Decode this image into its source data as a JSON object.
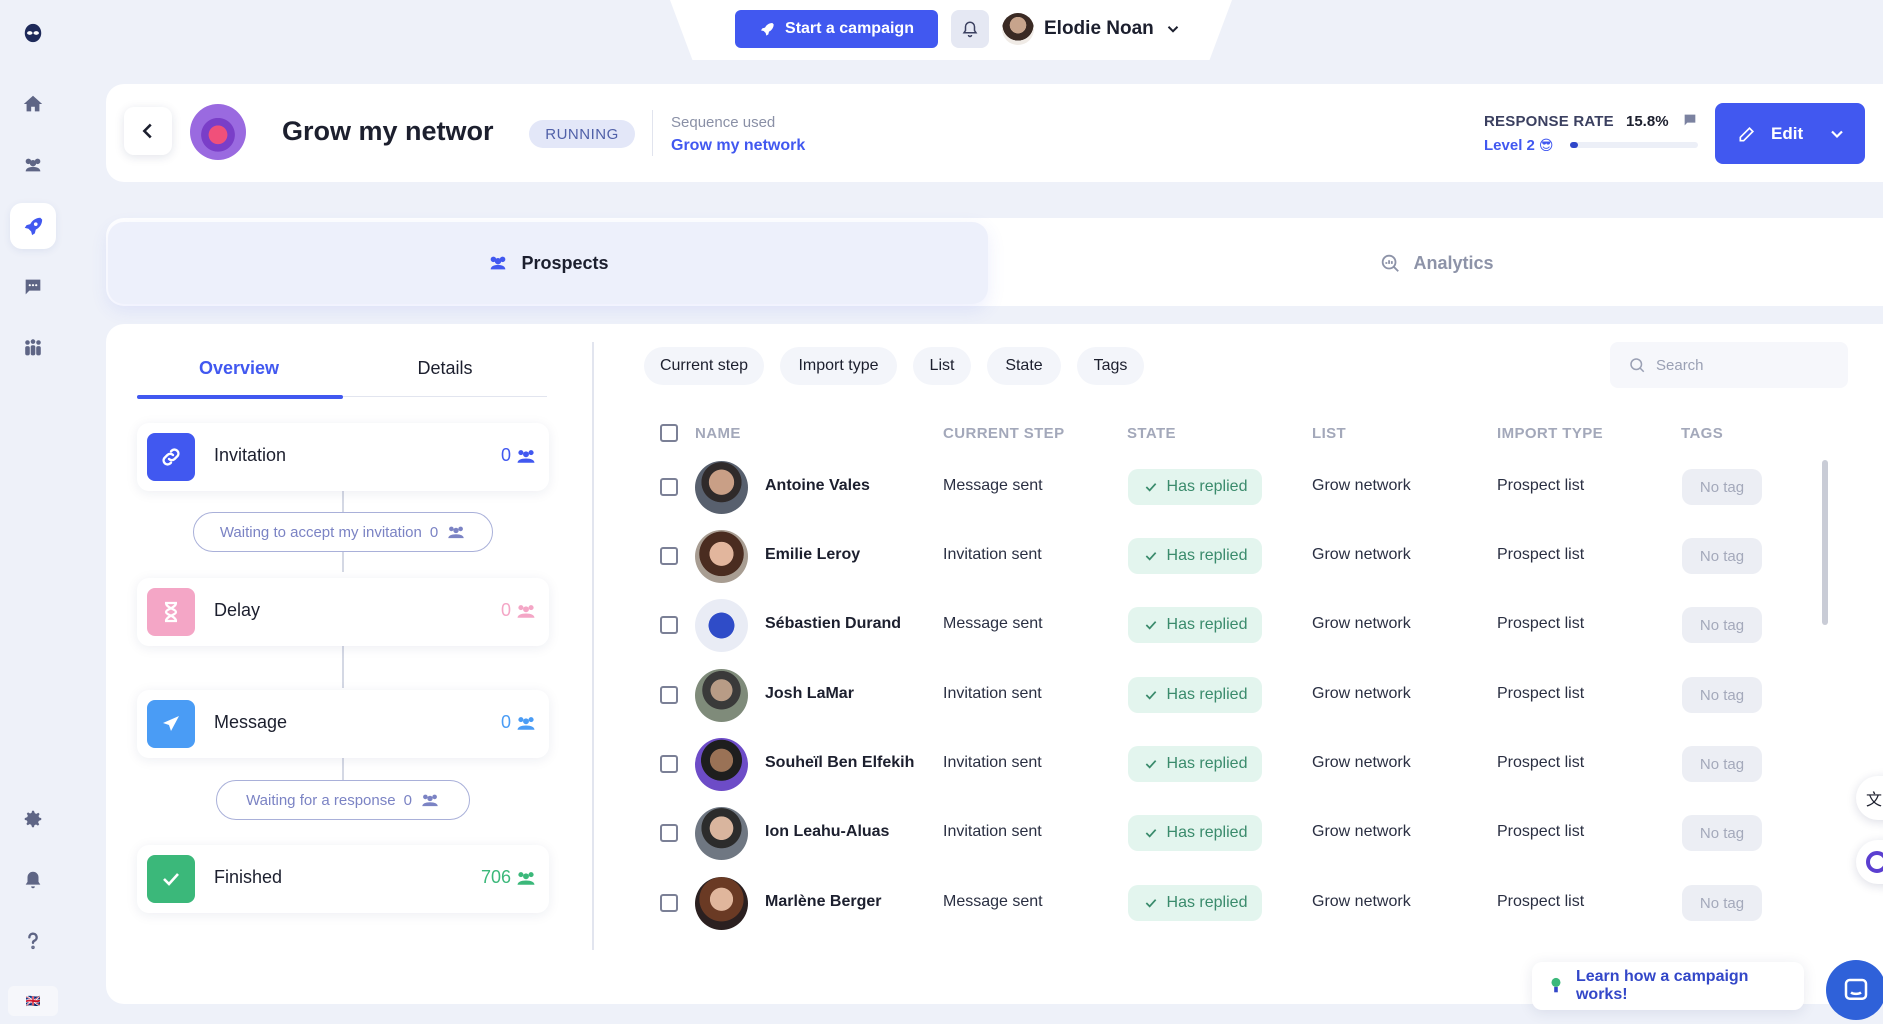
{
  "topbar": {
    "start_campaign": "Start a campaign",
    "user_name": "Elodie Noan"
  },
  "header": {
    "title": "Grow my networ",
    "status": "RUNNING",
    "sequence_label": "Sequence used",
    "sequence_value": "Grow my network",
    "response_rate_label": "RESPONSE RATE",
    "response_rate_value": "15.8%",
    "level_label": "Level 2",
    "level_emoji": "😎",
    "level_progress": 0.06,
    "edit_label": "Edit"
  },
  "tabs": {
    "prospects": "Prospects",
    "analytics": "Analytics"
  },
  "subtabs": {
    "overview": "Overview",
    "details": "Details"
  },
  "steps": [
    {
      "label": "Invitation",
      "count": "0",
      "color": "#4158f0"
    },
    {
      "label": "Delay",
      "count": "0",
      "color": "#f4a6c6"
    },
    {
      "label": "Message",
      "count": "0",
      "color": "#4a9cf5"
    },
    {
      "label": "Finished",
      "count": "706",
      "color": "#3bb87a"
    }
  ],
  "waits": [
    {
      "label": "Waiting to accept my invitation",
      "count": "0"
    },
    {
      "label": "Waiting for a response",
      "count": "0"
    }
  ],
  "filters": [
    "Current step",
    "Import type",
    "List",
    "State",
    "Tags"
  ],
  "search": {
    "placeholder": "Search"
  },
  "table": {
    "headers": [
      "NAME",
      "CURRENT STEP",
      "STATE",
      "LIST",
      "IMPORT TYPE",
      "TAGS"
    ],
    "rows": [
      {
        "name": "Antoine Vales",
        "step": "Message sent",
        "state": "Has replied",
        "list": "Grow network",
        "import": "Prospect list",
        "tag": "No tag"
      },
      {
        "name": "Emilie Leroy",
        "step": "Invitation sent",
        "state": "Has replied",
        "list": "Grow network",
        "import": "Prospect list",
        "tag": "No tag"
      },
      {
        "name": "Sébastien Durand",
        "step": "Message sent",
        "state": "Has replied",
        "list": "Grow network",
        "import": "Prospect list",
        "tag": "No tag"
      },
      {
        "name": "Josh LaMar",
        "step": "Invitation sent",
        "state": "Has replied",
        "list": "Grow network",
        "import": "Prospect list",
        "tag": "No tag"
      },
      {
        "name": "Souheïl Ben Elfekih",
        "step": "Invitation sent",
        "state": "Has replied",
        "list": "Grow network",
        "import": "Prospect list",
        "tag": "No tag"
      },
      {
        "name": "Ion Leahu-Aluas",
        "step": "Invitation sent",
        "state": "Has replied",
        "list": "Grow network",
        "import": "Prospect list",
        "tag": "No tag"
      },
      {
        "name": "Marlène Berger",
        "step": "Message sent",
        "state": "Has replied",
        "list": "Grow network",
        "import": "Prospect list",
        "tag": "No tag"
      }
    ]
  },
  "learn_link": "Learn how a campaign works!",
  "language_flag": "🇬🇧",
  "colors": {
    "accent": "#4158f0",
    "replied_bg": "#e3f5ee",
    "replied_text": "#3a8b6c"
  }
}
